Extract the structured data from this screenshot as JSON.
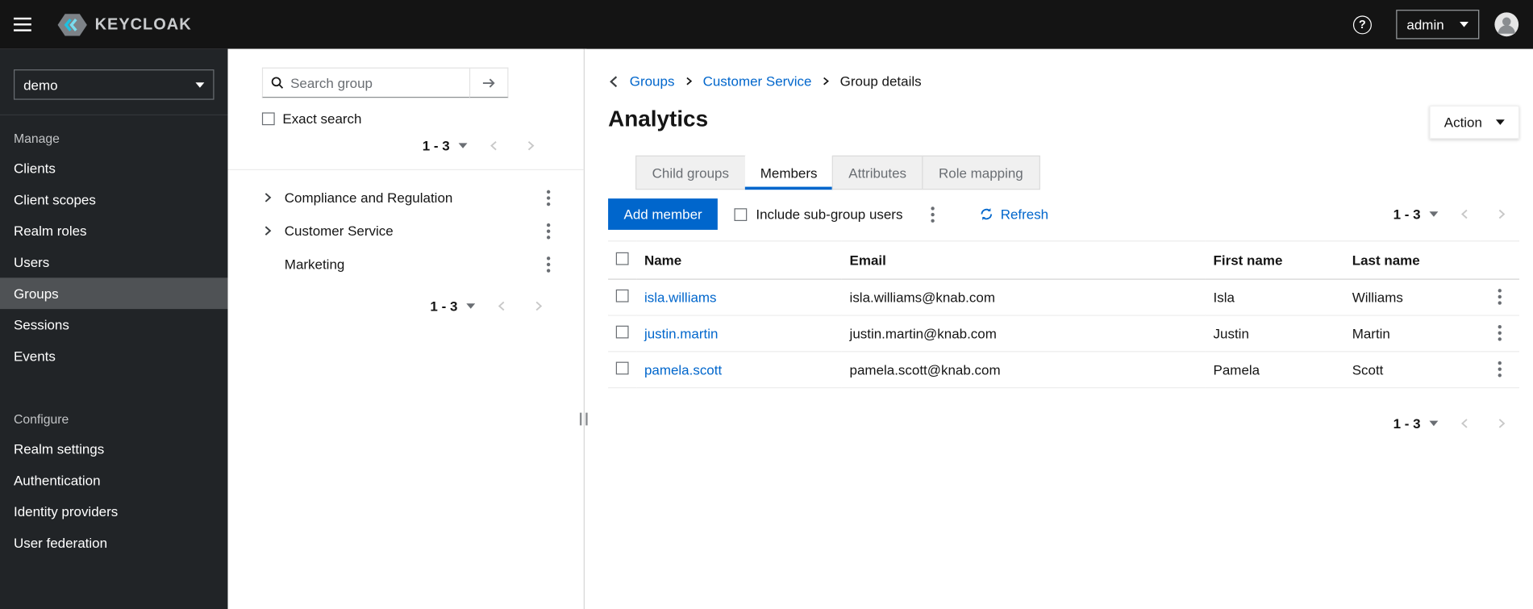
{
  "masthead": {
    "brand": "KEYCLOAK",
    "help_glyph": "?",
    "user_menu_label": "admin"
  },
  "sidebar": {
    "realm_selector": "demo",
    "sections": [
      {
        "label": "Manage",
        "items": [
          "Clients",
          "Client scopes",
          "Realm roles",
          "Users",
          "Groups",
          "Sessions",
          "Events"
        ],
        "active_item": "Groups"
      },
      {
        "label": "Configure",
        "items": [
          "Realm settings",
          "Authentication",
          "Identity providers",
          "User federation"
        ]
      }
    ]
  },
  "tree_panel": {
    "search_placeholder": "Search group",
    "exact_search_label": "Exact search",
    "pagination_label": "1 - 3",
    "groups": [
      "Compliance and Regulation",
      "Customer Service",
      "Marketing"
    ]
  },
  "main": {
    "breadcrumb": [
      "Groups",
      "Customer Service",
      "Group details"
    ],
    "title": "Analytics",
    "action_button_label": "Action",
    "tabs": [
      "Child groups",
      "Members",
      "Attributes",
      "Role mapping"
    ],
    "active_tab": "Members",
    "toolbar": {
      "add_member_label": "Add member",
      "include_subgroups_label": "Include sub-group users",
      "refresh_label": "Refresh",
      "pagination_label": "1 - 3"
    },
    "table": {
      "headers": [
        "Name",
        "Email",
        "First name",
        "Last name"
      ],
      "rows": [
        {
          "name": "isla.williams",
          "email": "isla.williams@knab.com",
          "first_name": "Isla",
          "last_name": "Williams"
        },
        {
          "name": "justin.martin",
          "email": "justin.martin@knab.com",
          "first_name": "Justin",
          "last_name": "Martin"
        },
        {
          "name": "pamela.scott",
          "email": "pamela.scott@knab.com",
          "first_name": "Pamela",
          "last_name": "Scott"
        }
      ]
    },
    "bottom_pagination_label": "1 - 3"
  },
  "colors": {
    "accent": "#0066cc",
    "link": "#0066cc",
    "masthead_bg": "#141414",
    "sidebar_bg": "#212427",
    "sidebar_active_bg": "#4f5255",
    "tab_inactive_bg": "#f0f0f0"
  },
  "icons": {
    "hamburger-icon": "three-bars",
    "keycloak-logo-icon": "hex-shield-with-cyan-chevrons",
    "help-icon": "?",
    "caret-down-icon": "▾",
    "avatar-icon": "person-silhouette",
    "search-icon": "magnifier",
    "arrow-right-icon": "→",
    "angle-right-icon": "›",
    "angle-left-icon": "‹",
    "kebab-icon": "⋮",
    "refresh-icon": "⟳"
  }
}
